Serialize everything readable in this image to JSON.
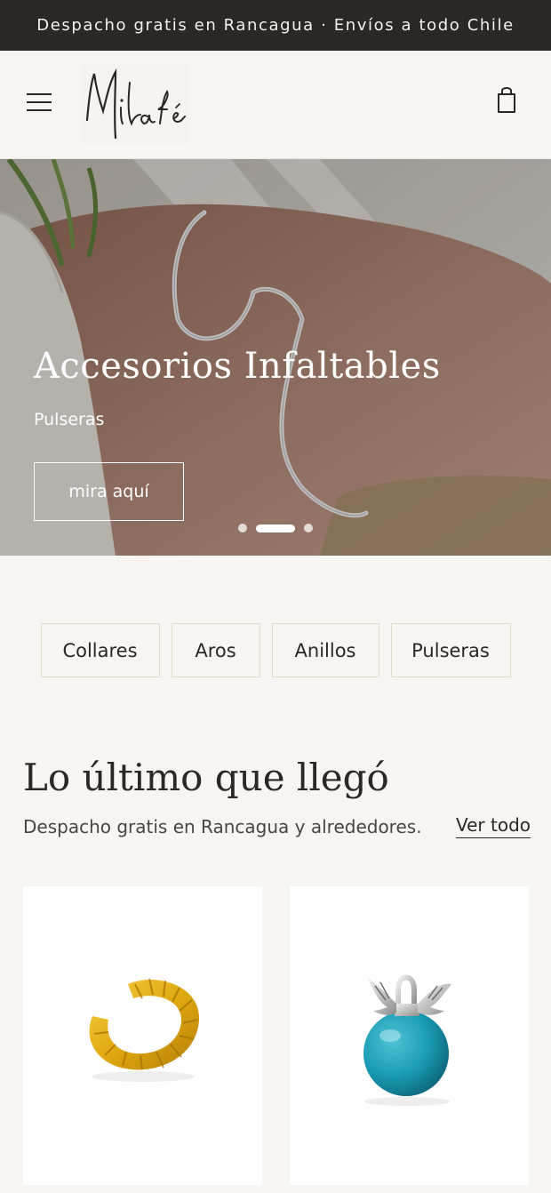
{
  "announcement": "Despacho gratis en Rancagua · Envíos a todo Chile",
  "header": {
    "logo_text": "Milafé",
    "icons": [
      "menu-icon",
      "shopping-bag-icon"
    ]
  },
  "hero": {
    "title": "Accesorios Infaltables",
    "subtitle": "Pulseras",
    "button_label": "mira aquí",
    "slides_count": 3,
    "active_slide": 2
  },
  "categories": [
    "Collares",
    "Aros",
    "Anillos",
    "Pulseras"
  ],
  "section": {
    "title": "Lo último que llegó",
    "subtitle": "Despacho gratis en Rancagua y alrededores.",
    "view_all_label": "Ver todo"
  },
  "products": [
    {
      "image": "gold-twisted-ear-cuff"
    },
    {
      "image": "turquoise-ball-pendant-with-wings"
    }
  ],
  "colors": {
    "dark": "#2b2725",
    "background": "#f8f6f3",
    "category_border": "#e5d9c9"
  }
}
